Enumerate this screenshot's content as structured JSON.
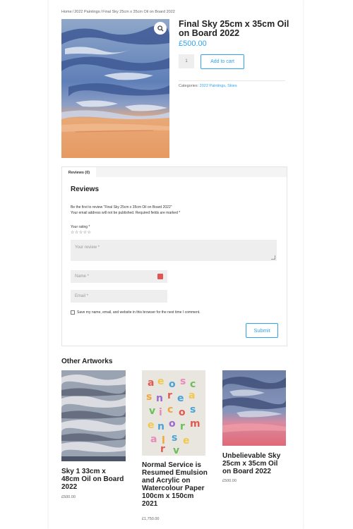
{
  "breadcrumb": {
    "home": "Home",
    "category": "2022 Paintings",
    "current": "Final Sky 25cm x 35cm Oil on Board 2022",
    "separator": "/"
  },
  "product": {
    "title": "Final Sky 25cm x 35cm Oil on Board 2022",
    "price": "£500.00",
    "quantity": "1",
    "add_to_cart": "Add to cart",
    "categories_label": "Categories:",
    "categories": [
      "2022 Paintings",
      "Skies"
    ]
  },
  "icons": {
    "zoom": "magnifier-icon",
    "autofill": "autofill-icon",
    "stars": "star-icon"
  },
  "reviews": {
    "tab_label": "Reviews (0)",
    "heading": "Reviews",
    "be_first": "Be the first to review “Final Sky 25cm x 35cm Oil on Board 2022”",
    "notes": "Your email address will not be published. Required fields are marked *",
    "rating_label": "Your rating *",
    "stars": "☆☆☆☆☆",
    "review_placeholder": "Your review *",
    "name_placeholder": "Name *",
    "email_placeholder": "Email *",
    "save_info": "Save my name, email, and website in this browser for the next time I comment.",
    "submit": "Submit"
  },
  "other": {
    "heading": "Other Artworks",
    "items": [
      {
        "title": "Sky 1 33cm x 48cm Oil on Board 2022",
        "price": "£500.00"
      },
      {
        "title": "Normal Service is Resumed Emulsion and Acrylic on Watercolour Paper 100cm x 150cm 2021",
        "price": "£1,750.00"
      },
      {
        "title": "Unbelievable Sky 25cm x 35cm Oil on Board 2022",
        "price": "£500.00"
      }
    ]
  },
  "colors": {
    "accent": "#2ea3f2",
    "field_bg": "#eeeeee"
  }
}
